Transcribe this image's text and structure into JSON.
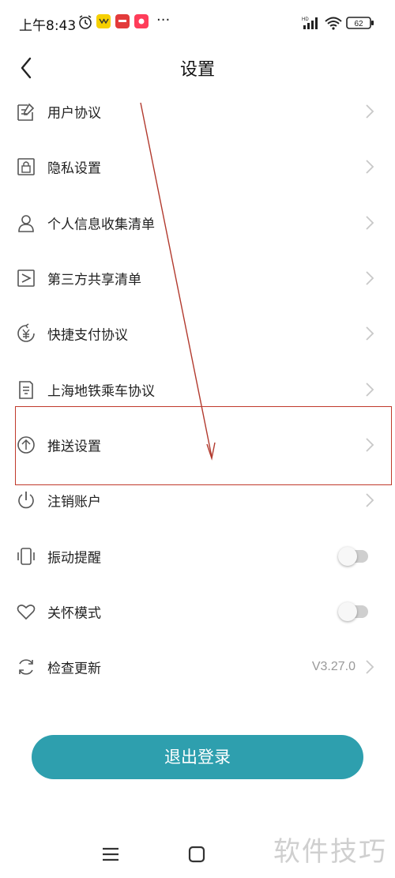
{
  "status_bar": {
    "time": "上午8:43",
    "more": "···",
    "hd": "HD",
    "battery": "62"
  },
  "header": {
    "title": "设置"
  },
  "menu": [
    {
      "label": "用户协议",
      "icon": "document-edit-icon"
    },
    {
      "label": "隐私设置",
      "icon": "lock-icon"
    },
    {
      "label": "个人信息收集清单",
      "icon": "person-icon"
    },
    {
      "label": "第三方共享清单",
      "icon": "share-icon"
    },
    {
      "label": "快捷支付协议",
      "icon": "yuan-payment-icon"
    },
    {
      "label": "上海地铁乘车协议",
      "icon": "metro-card-icon"
    },
    {
      "label": "推送设置",
      "icon": "push-icon"
    },
    {
      "label": "注销账户",
      "icon": "power-icon"
    },
    {
      "label": "振动提醒",
      "icon": "vibrate-icon",
      "toggle": false
    },
    {
      "label": "关怀模式",
      "icon": "heart-icon",
      "toggle": false
    },
    {
      "label": "检查更新",
      "icon": "refresh-icon",
      "version": "V3.27.0"
    }
  ],
  "logout": {
    "label": "退出登录"
  },
  "watermark": "软件技巧",
  "colors": {
    "accent": "#2e9fae",
    "highlight": "#c0392b"
  }
}
